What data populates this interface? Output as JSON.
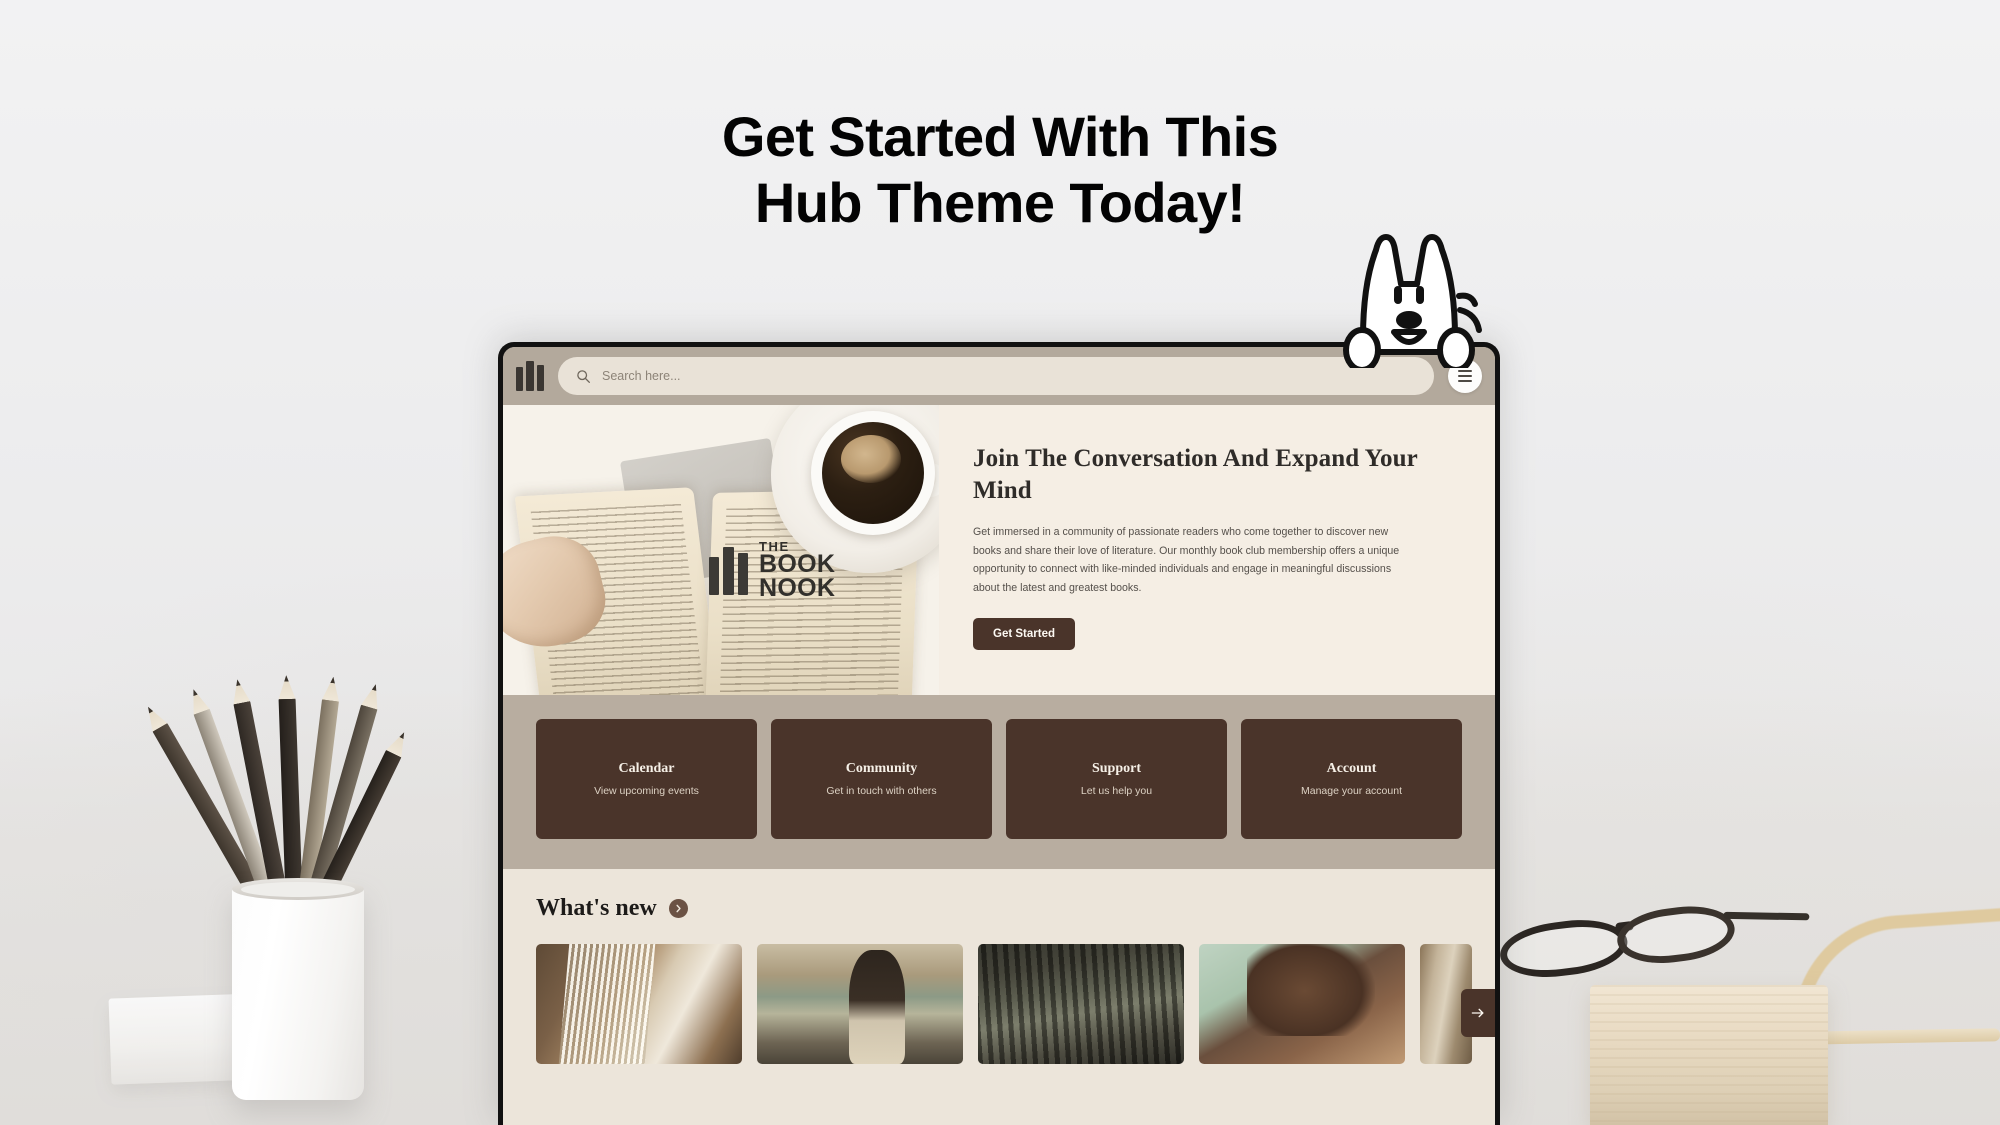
{
  "promo": {
    "headline_line1": "Get Started With This",
    "headline_line2": "Hub Theme Today!"
  },
  "mascot": {
    "name": "rabbit-mascot"
  },
  "browser": {
    "logo_icon": "book-spines-icon",
    "search": {
      "icon": "search-icon",
      "placeholder": "Search here...",
      "value": ""
    },
    "menu_button": {
      "icon": "hamburger-menu-icon",
      "label": "Menu"
    }
  },
  "hero": {
    "brand": {
      "icon": "book-spines-logo-icon",
      "line1": "THE",
      "line2": "BOOK",
      "line3": "NOOK"
    },
    "title": "Join The Conversation And Expand Your Mind",
    "body": "Get immersed in a community of passionate readers who come together to discover new books and share their love of literature. Our monthly book club membership offers a unique opportunity to connect with like-minded individuals and engage in meaningful discussions about the latest and greatest books.",
    "cta_label": "Get Started",
    "photo_alt": "hand-holding-open-book-with-coffee-cup"
  },
  "quick_links": [
    {
      "title": "Calendar",
      "subtitle": "View upcoming events"
    },
    {
      "title": "Community",
      "subtitle": "Get in touch with others"
    },
    {
      "title": "Support",
      "subtitle": "Let us help you"
    },
    {
      "title": "Account",
      "subtitle": "Manage your account"
    }
  ],
  "whats_new": {
    "title": "What's new",
    "next_icon": "chevron-right-icon",
    "carousel_next_icon": "arrow-right-icon",
    "thumbnails": [
      {
        "alt": "stack-of-open-books"
      },
      {
        "alt": "woman-sitting-by-lake"
      },
      {
        "alt": "dark-forest-path"
      },
      {
        "alt": "portrait-of-woman-resting-on-arm"
      },
      {
        "alt": "bookshelf-partial"
      }
    ]
  },
  "scene": {
    "left_props": [
      "pencil-cup",
      "stacked-books"
    ],
    "right_props": [
      "eyeglasses",
      "wooden-block",
      "wooden-handle"
    ]
  },
  "colors": {
    "page_bg": "#f0f0f1",
    "brand_dark": "#4a342a",
    "band_taupe": "#b8ada0",
    "header_taupe": "#b3a99c",
    "cream": "#ece5da",
    "hero_cream": "#f5eee4",
    "search_field": "#e9e2d7",
    "headline": "#030303"
  }
}
